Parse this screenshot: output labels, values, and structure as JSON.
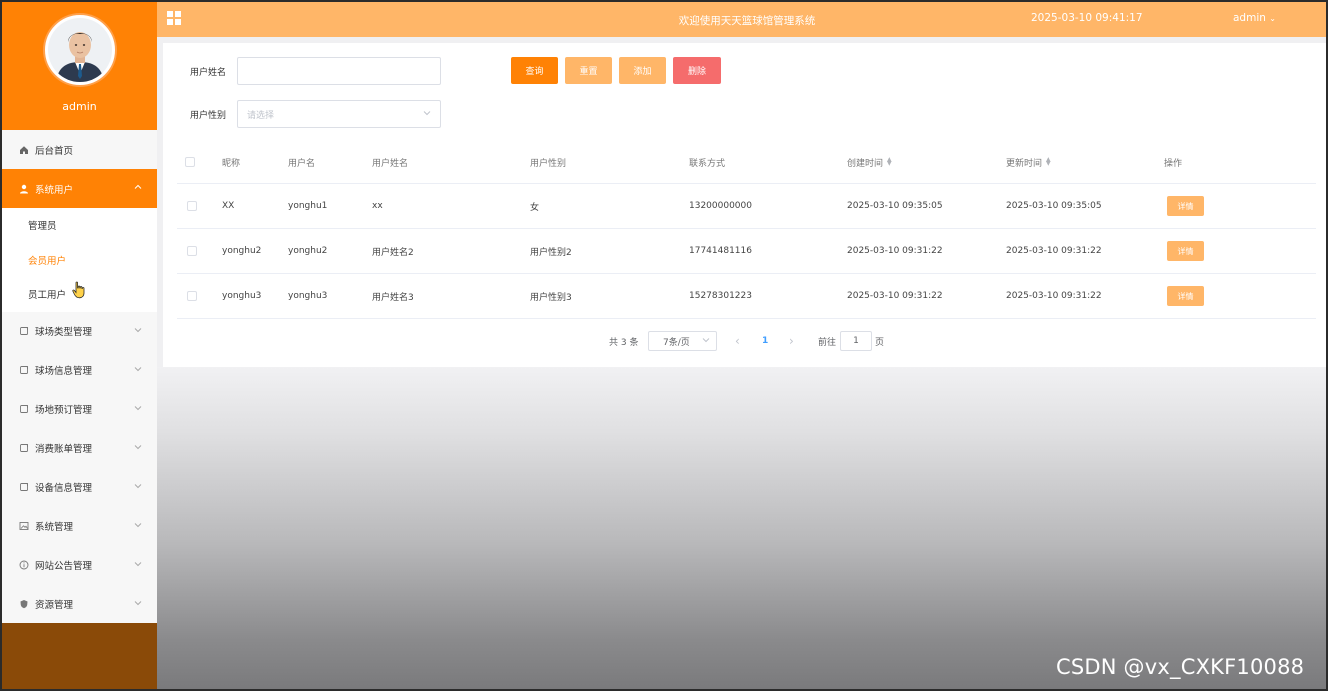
{
  "profile": {
    "name": "admin"
  },
  "header": {
    "title": "欢迎使用天天篮球馆管理系统",
    "datetime": "2025-03-10 09:41:17",
    "user": "admin"
  },
  "sidebar": {
    "items": [
      {
        "label": "后台首页",
        "icon": "home-icon"
      },
      {
        "label": "系统用户",
        "icon": "user-icon",
        "active": true
      },
      {
        "label": "球场类型管理",
        "icon": "doc-icon"
      },
      {
        "label": "球场信息管理",
        "icon": "doc-icon"
      },
      {
        "label": "场地预订管理",
        "icon": "doc-icon"
      },
      {
        "label": "消费账单管理",
        "icon": "doc-icon"
      },
      {
        "label": "设备信息管理",
        "icon": "doc-icon"
      },
      {
        "label": "系统管理",
        "icon": "picture-icon"
      },
      {
        "label": "网站公告管理",
        "icon": "info-icon"
      },
      {
        "label": "资源管理",
        "icon": "shield-icon"
      }
    ],
    "subitems": [
      {
        "label": "管理员"
      },
      {
        "label": "会员用户",
        "current": true
      },
      {
        "label": "员工用户"
      }
    ]
  },
  "search": {
    "name_label": "用户姓名",
    "name_value": "",
    "gender_label": "用户性别",
    "gender_placeholder": "请选择"
  },
  "buttons": {
    "query": "查询",
    "reset": "重置",
    "add": "添加",
    "delete": "删除"
  },
  "colors": {
    "accent": "#ff8205",
    "accent_light": "#ffb668",
    "danger": "#f56c6c"
  },
  "table": {
    "columns": [
      "昵称",
      "用户名",
      "用户姓名",
      "用户性别",
      "联系方式",
      "创建时间",
      "更新时间",
      "操作"
    ],
    "rows": [
      {
        "nickname": "XX",
        "username": "yonghu1",
        "realname": "xx",
        "gender": "女",
        "phone": "13200000000",
        "created": "2025-03-10 09:35:05",
        "updated": "2025-03-10 09:35:05",
        "action": "详情"
      },
      {
        "nickname": "yonghu2",
        "username": "yonghu2",
        "realname": "用户姓名2",
        "gender": "用户性别2",
        "phone": "17741481116",
        "created": "2025-03-10 09:31:22",
        "updated": "2025-03-10 09:31:22",
        "action": "详情"
      },
      {
        "nickname": "yonghu3",
        "username": "yonghu3",
        "realname": "用户姓名3",
        "gender": "用户性别3",
        "phone": "15278301223",
        "created": "2025-03-10 09:31:22",
        "updated": "2025-03-10 09:31:22",
        "action": "详情"
      }
    ]
  },
  "pagination": {
    "total": "共 3 条",
    "page_size": "7条/页",
    "prev": "‹",
    "current": "1",
    "next": "›",
    "goto_label": "前往",
    "goto_value": "1",
    "goto_unit": "页"
  },
  "watermark": "CSDN @vx_CXKF10088"
}
